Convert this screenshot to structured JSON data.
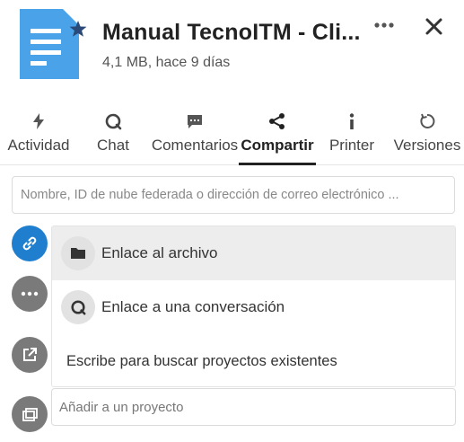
{
  "header": {
    "title": "Manual TecnoITM - Cli...",
    "subtitle": "4,1 MB, hace 9 días",
    "file_icon": "document-icon",
    "favorite_icon": "star-icon",
    "more_icon": "more-horizontal-icon",
    "close_icon": "close-icon"
  },
  "tabs": [
    {
      "label": "Actividad",
      "icon": "bolt-icon"
    },
    {
      "label": "Chat",
      "icon": "chat-icon"
    },
    {
      "label": "Comentarios",
      "icon": "comment-icon"
    },
    {
      "label": "Compartir",
      "icon": "share-icon",
      "active": true
    },
    {
      "label": "Printer",
      "icon": "info-icon"
    },
    {
      "label": "Versiones",
      "icon": "history-icon"
    }
  ],
  "share": {
    "placeholder": "Nombre, ID de nube federada o dirección de correo electrónico ..."
  },
  "menu": {
    "items": [
      {
        "label": "Enlace al archivo",
        "icon": "folder-icon"
      },
      {
        "label": "Enlace a una conversación",
        "icon": "chat-icon"
      },
      {
        "label": "Escribe para buscar proyectos existentes"
      }
    ]
  },
  "project": {
    "placeholder": "Añadir a un proyecto"
  },
  "colors": {
    "accent": "#1f7fce",
    "file_icon": "#4aa3e8",
    "active_tab": "#222222"
  }
}
